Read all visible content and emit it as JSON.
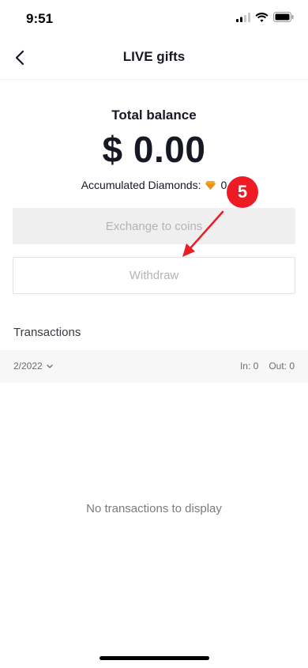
{
  "status_bar": {
    "time": "9:51"
  },
  "nav": {
    "title": "LIVE gifts"
  },
  "balance": {
    "title": "Total balance",
    "amount": "$ 0.00",
    "diamonds_label": "Accumulated Diamonds:",
    "diamonds_value": "0"
  },
  "actions": {
    "exchange_label": "Exchange to coins",
    "withdraw_label": "Withdraw"
  },
  "transactions": {
    "heading": "Transactions",
    "month": "2/2022",
    "in_label": "In: 0",
    "out_label": "Out: 0",
    "empty_text": "No transactions to display"
  },
  "annotation": {
    "step_number": "5",
    "color": "#ed1c24"
  },
  "icons": [
    "signal-icon",
    "wifi-icon",
    "battery-icon",
    "back-arrow-icon",
    "diamond-icon",
    "chevron-down-icon"
  ]
}
